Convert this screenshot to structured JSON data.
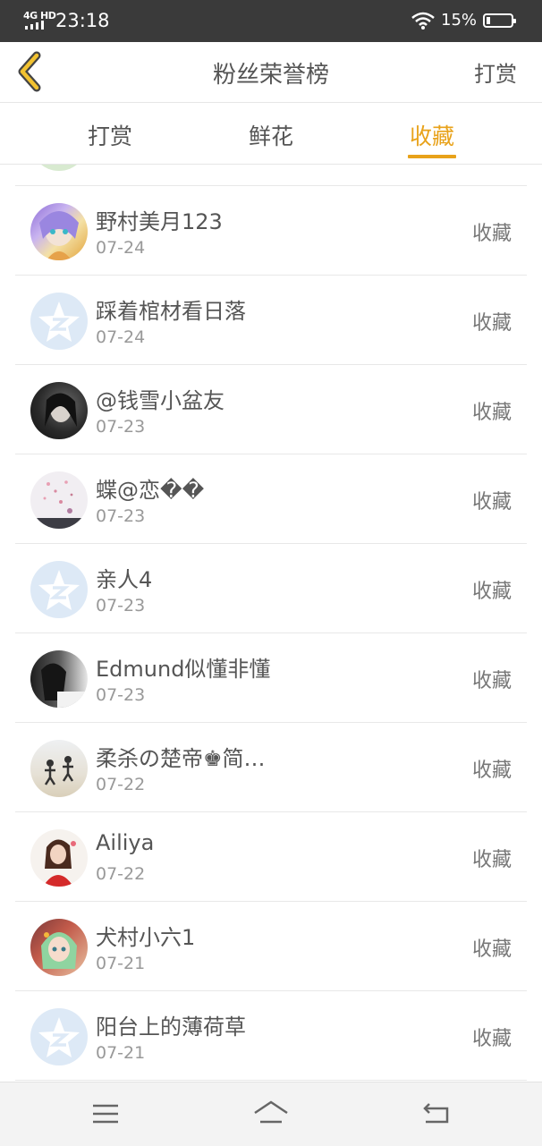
{
  "status_bar": {
    "network": "4G HD",
    "time": "23:18",
    "battery": "15%",
    "battery_level": 0.15,
    "icons": [
      "signal-icon",
      "wifi-icon",
      "battery-icon"
    ]
  },
  "header": {
    "title": "粉丝荣誉榜",
    "right_action": "打赏",
    "back_icon": "chevron-left-icon"
  },
  "tabs": [
    {
      "label": "打赏",
      "active": false
    },
    {
      "label": "鲜花",
      "active": false
    },
    {
      "label": "收藏",
      "active": true
    }
  ],
  "colors": {
    "accent": "#e8a21a",
    "status_bar": "#3a3a3a",
    "divider": "#e8e8e8",
    "default_avatar": "#dde9f6"
  },
  "list": [
    {
      "name": "野村美月123",
      "date": "07-24",
      "action": "收藏",
      "avatar": "anime-avatar-purple"
    },
    {
      "name": "踩着棺材看日落",
      "date": "07-24",
      "action": "收藏",
      "avatar": "default-star-avatar"
    },
    {
      "name": "@钱雪小盆友",
      "date": "07-23",
      "action": "收藏",
      "avatar": "dark-photo-avatar"
    },
    {
      "name": "蝶@恋��",
      "date": "07-23",
      "action": "收藏",
      "avatar": "pink-blossom-avatar"
    },
    {
      "name": "亲人4",
      "date": "07-23",
      "action": "收藏",
      "avatar": "default-star-avatar"
    },
    {
      "name": "Edmund似懂非懂",
      "date": "07-23",
      "action": "收藏",
      "avatar": "bw-photo-avatar"
    },
    {
      "name": "柔杀の楚帝♚简…",
      "date": "07-22",
      "action": "收藏",
      "avatar": "beach-photo-avatar"
    },
    {
      "name": "Ailiya",
      "date": "07-22",
      "action": "收藏",
      "avatar": "red-dress-avatar"
    },
    {
      "name": "犬村小六1",
      "date": "07-21",
      "action": "收藏",
      "avatar": "anime-avatar-green"
    },
    {
      "name": "阳台上的薄荷草",
      "date": "07-21",
      "action": "收藏",
      "avatar": "default-star-avatar"
    }
  ],
  "bottom_nav": [
    "menu-icon",
    "home-icon",
    "back-icon"
  ]
}
